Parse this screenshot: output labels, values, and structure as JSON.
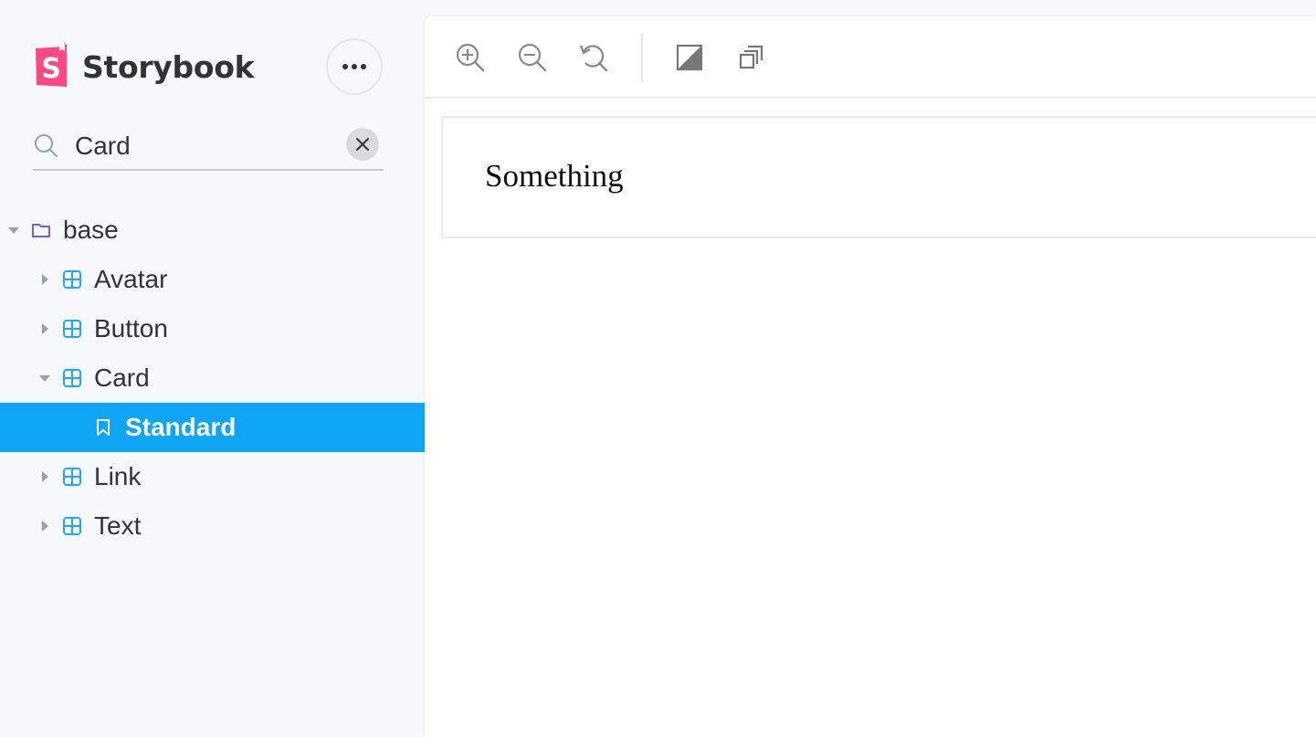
{
  "app": {
    "brand_name": "Storybook",
    "brand_color": "#ff4785",
    "accent_color": "#0ea5f4"
  },
  "search": {
    "value": "Card",
    "placeholder": "Find components",
    "icon": "search-icon",
    "clear_icon": "close-icon"
  },
  "menu": {
    "icon": "ellipsis-icon"
  },
  "tree": {
    "folder": {
      "label": "base",
      "icon": "folder-icon",
      "expanded": true
    },
    "items": [
      {
        "label": "Avatar",
        "icon": "component-icon",
        "expanded": false
      },
      {
        "label": "Button",
        "icon": "component-icon",
        "expanded": false
      },
      {
        "label": "Card",
        "icon": "component-icon",
        "expanded": true
      },
      {
        "label": "Standard",
        "icon": "bookmark-icon",
        "selected": true
      },
      {
        "label": "Link",
        "icon": "component-icon",
        "expanded": false
      },
      {
        "label": "Text",
        "icon": "component-icon",
        "expanded": false
      }
    ]
  },
  "toolbar": {
    "tools": [
      "zoom-in-icon",
      "zoom-out-icon",
      "reset-zoom-icon",
      "background-icon",
      "outline-icon"
    ]
  },
  "preview": {
    "text": "Something"
  }
}
